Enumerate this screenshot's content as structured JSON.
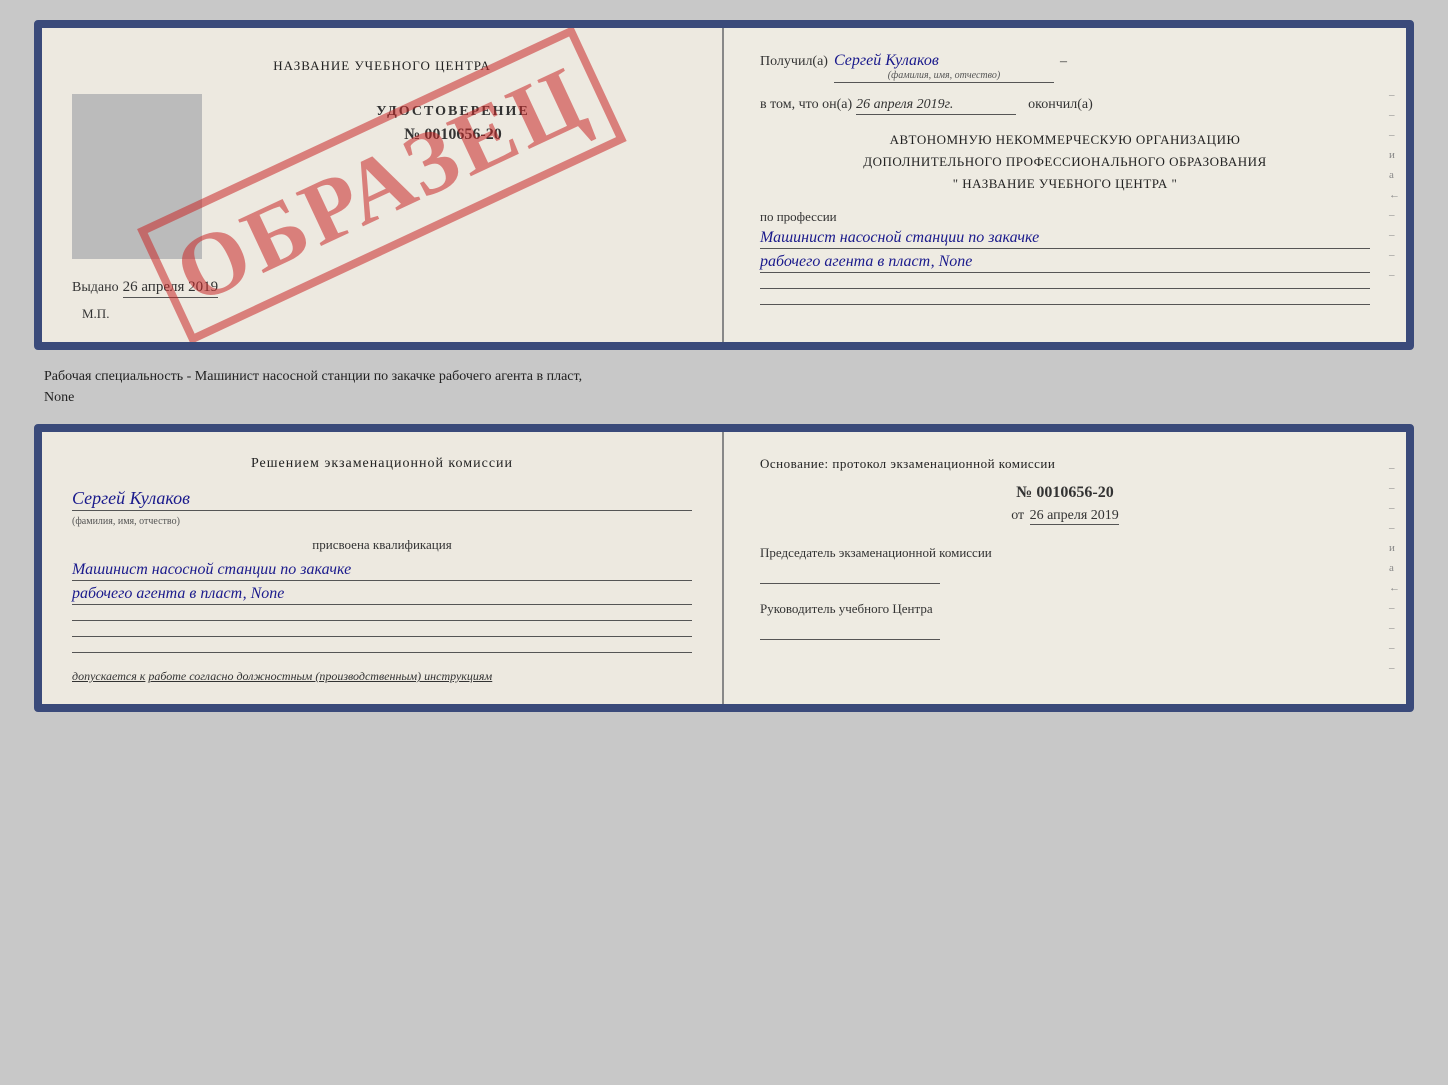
{
  "topDocument": {
    "left": {
      "title": "НАЗВАНИЕ УЧЕБНОГО ЦЕНТРА",
      "watermark": "ОБРАЗЕЦ",
      "udostoverenie": {
        "label": "УДОСТОВЕРЕНИЕ",
        "number": "№ 0010656-20"
      },
      "vidano": "Выдано",
      "vidanoDate": "26 апреля 2019",
      "mp": "М.П."
    },
    "right": {
      "poluchil": "Получил(а)",
      "name": "Сергей Кулаков",
      "nameSub": "(фамилия, имя, отчество)",
      "vtomchto": "в том, что он(а)",
      "date": "26 апреля 2019г.",
      "okonchil": "окончил(а)",
      "orgLines": [
        "АВТОНОМНУЮ НЕКОММЕРЧЕСКУЮ ОРГАНИЗАЦИЮ",
        "ДОПОЛНИТЕЛЬНОГО ПРОФЕССИОНАЛЬНОГО ОБРАЗОВАНИЯ",
        "\"   НАЗВАНИЕ УЧЕБНОГО ЦЕНТРА   \""
      ],
      "professiyaLabel": "по профессии",
      "profession1": "Машинист насосной станции по закачке",
      "profession2": "рабочего агента в пласт, None",
      "sideChars": [
        "-",
        "-",
        "-",
        "и",
        "а",
        "←",
        "-",
        "-",
        "-",
        "-"
      ]
    }
  },
  "middleText": {
    "line1": "Рабочая специальность - Машинист насосной станции по закачке рабочего агента в пласт,",
    "line2": "None"
  },
  "bottomDocument": {
    "left": {
      "kommissiyaTitle": "Решением  экзаменационной  комиссии",
      "name": "Сергей Кулаков",
      "nameSub": "(фамилия, имя, отчество)",
      "prisvoena": "присвоена квалификация",
      "qualification1": "Машинист насосной станции по закачке",
      "qualification2": "рабочего агента в пласт, None",
      "dopuskaetsya": "допускается к",
      "dopuskaetsyaVal": "работе согласно должностным (производственным) инструкциям"
    },
    "right": {
      "osnovaniye": "Основание:  протокол  экзаменационной  комиссии",
      "protocolNumber": "№  0010656-20",
      "protocolDatePrefix": "от",
      "protocolDate": "26 апреля 2019",
      "predsedatelLabel": "Председатель экзаменационной комиссии",
      "rukovoditelLabel": "Руководитель учебного Центра",
      "sideChars": [
        "-",
        "-",
        "-",
        "-",
        "и",
        "а",
        "←",
        "-",
        "-",
        "-",
        "-"
      ]
    }
  }
}
